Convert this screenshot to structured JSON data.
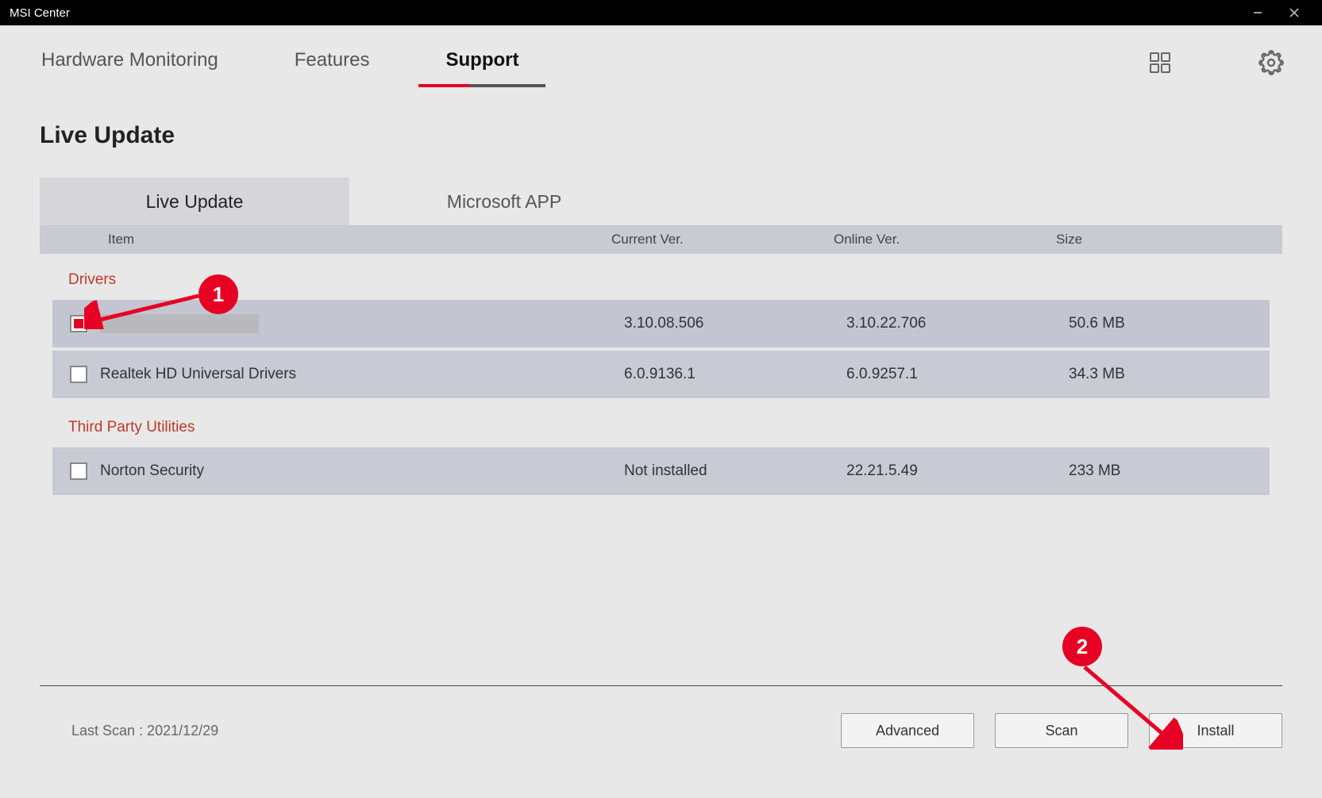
{
  "window": {
    "title": "MSI Center"
  },
  "nav": {
    "tabs": [
      "Hardware Monitoring",
      "Features",
      "Support"
    ],
    "active": 2
  },
  "page": {
    "title": "Live Update"
  },
  "subtabs": {
    "items": [
      "Live Update",
      "Microsoft APP"
    ],
    "active": 0
  },
  "table": {
    "headers": {
      "item": "Item",
      "current": "Current Ver.",
      "online": "Online Ver.",
      "size": "Size"
    },
    "groups": [
      {
        "label": "Drivers",
        "rows": [
          {
            "checked": true,
            "name": "",
            "redacted": true,
            "current": "3.10.08.506",
            "online": "3.10.22.706",
            "size": "50.6 MB"
          },
          {
            "checked": false,
            "name": "Realtek HD Universal Drivers",
            "redacted": false,
            "current": "6.0.9136.1",
            "online": "6.0.9257.1",
            "size": "34.3 MB"
          }
        ]
      },
      {
        "label": "Third Party Utilities",
        "rows": [
          {
            "checked": false,
            "name": "Norton Security",
            "redacted": false,
            "current": "Not installed",
            "online": "22.21.5.49",
            "size": "233 MB"
          }
        ]
      }
    ]
  },
  "footer": {
    "last_scan": "Last Scan : 2021/12/29",
    "buttons": {
      "advanced": "Advanced",
      "scan": "Scan",
      "install": "Install"
    }
  },
  "annotations": {
    "a1": "1",
    "a2": "2"
  }
}
